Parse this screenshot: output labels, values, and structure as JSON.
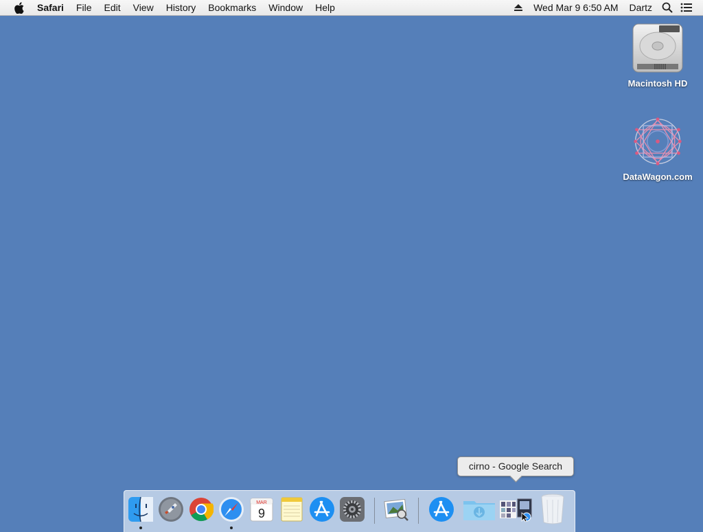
{
  "menubar": {
    "app_name": "Safari",
    "menus": [
      "File",
      "Edit",
      "View",
      "History",
      "Bookmarks",
      "Window",
      "Help"
    ],
    "datetime": "Wed Mar 9  6:50 AM",
    "user": "Dartz"
  },
  "desktop": {
    "icons": [
      {
        "label": "Macintosh HD",
        "icon": "hard-drive-icon"
      },
      {
        "label": "DataWagon.com",
        "icon": "network-volume-icon"
      }
    ]
  },
  "tooltip": {
    "text": "cirno - Google Search"
  },
  "dock": {
    "items": [
      {
        "name": "finder",
        "running": true
      },
      {
        "name": "launchpad",
        "running": false
      },
      {
        "name": "chrome",
        "running": false
      },
      {
        "name": "safari",
        "running": true
      },
      {
        "name": "calendar",
        "running": false,
        "month": "MAR",
        "day": "9"
      },
      {
        "name": "notes",
        "running": false
      },
      {
        "name": "app-store",
        "running": false
      },
      {
        "name": "system-preferences",
        "running": false
      },
      {
        "name": "preview",
        "running": false
      },
      {
        "name": "applications-folder",
        "running": false
      },
      {
        "name": "downloads-folder",
        "running": false
      },
      {
        "name": "safari-window-minimized",
        "running": false
      },
      {
        "name": "trash",
        "running": false
      }
    ]
  }
}
